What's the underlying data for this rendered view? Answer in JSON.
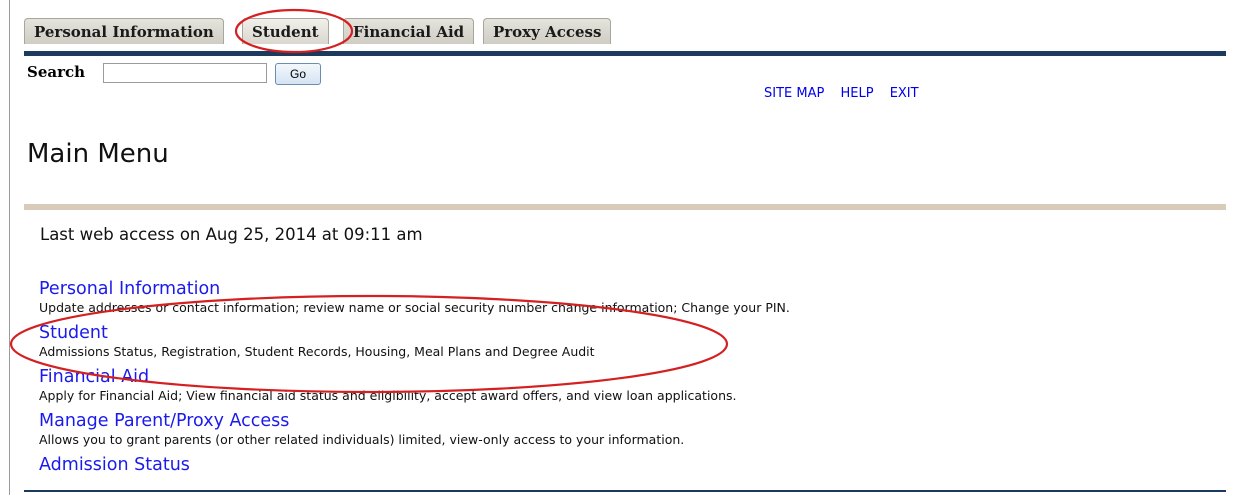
{
  "tabs": [
    {
      "label": "Personal Information"
    },
    {
      "label": "Student"
    },
    {
      "label": "Financial Aid"
    },
    {
      "label": "Proxy Access"
    }
  ],
  "search": {
    "label": "Search",
    "value": "",
    "button_label": "Go"
  },
  "top_links": {
    "site_map": "SITE MAP",
    "help": "HELP",
    "exit": "EXIT"
  },
  "page_title": "Main Menu",
  "last_access": "Last web access on Aug 25, 2014 at 09:11 am",
  "menu": [
    {
      "title": "Personal Information",
      "description": "Update addresses or contact information; review name or social security number change information; Change your PIN."
    },
    {
      "title": "Student",
      "description": "Admissions Status, Registration, Student Records, Housing, Meal Plans and Degree Audit"
    },
    {
      "title": "Financial Aid",
      "description": "Apply for Financial Aid; View financial aid status and eligibility, accept award offers, and view loan applications."
    },
    {
      "title": "Manage Parent/Proxy Access",
      "description": "Allows you to grant parents (or other related individuals) limited, view-only access to your information."
    },
    {
      "title": "Admission Status",
      "description": ""
    }
  ],
  "colors": {
    "link": "#1a1aee",
    "tab_rule": "#1b3a5e",
    "annotation": "#d42020"
  }
}
